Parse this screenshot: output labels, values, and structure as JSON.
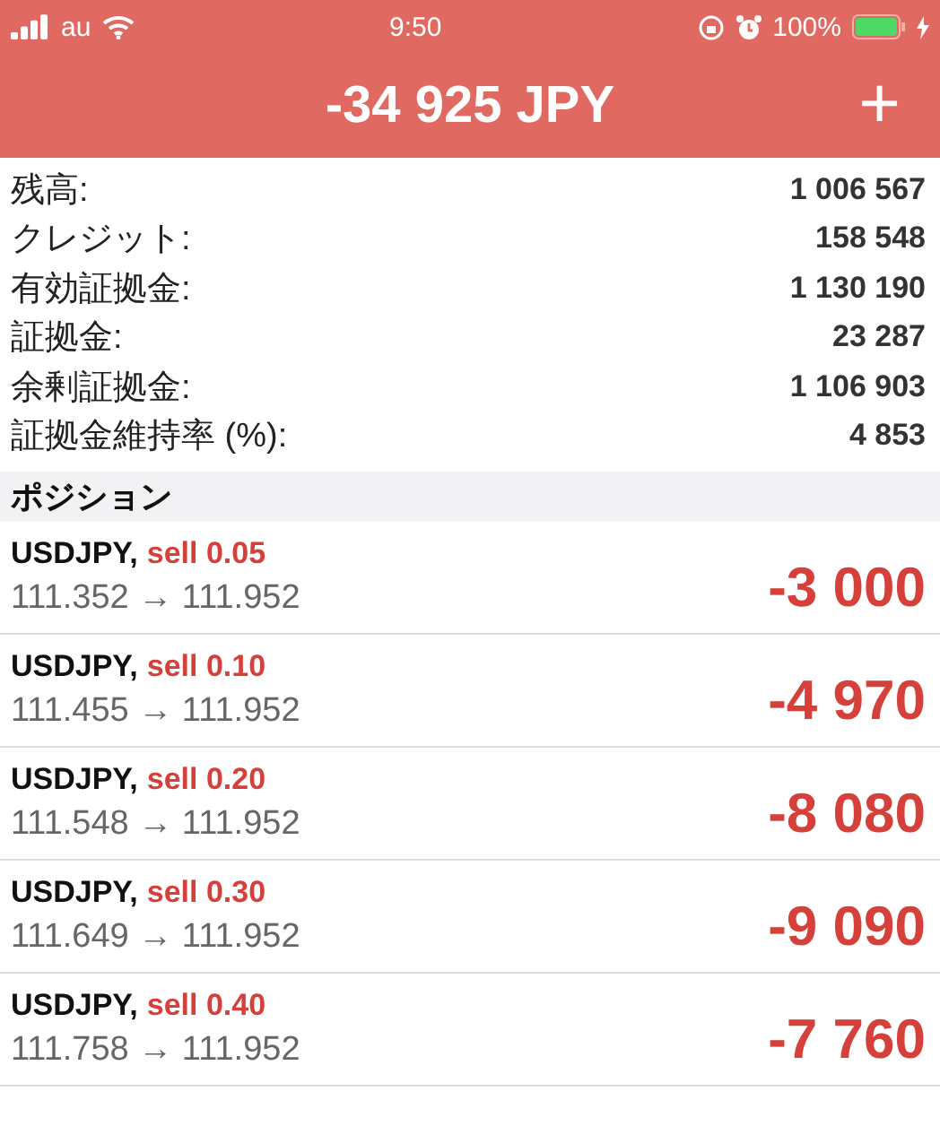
{
  "status_bar": {
    "carrier": "au",
    "time": "9:50",
    "battery": "100%"
  },
  "header": {
    "title": "-34 925 JPY",
    "action": "+"
  },
  "summary": [
    {
      "label": "残高:",
      "value": "1 006 567"
    },
    {
      "label": "クレジット:",
      "value": "158 548"
    },
    {
      "label": "有効証拠金:",
      "value": "1 130 190"
    },
    {
      "label": "証拠金:",
      "value": "23 287"
    },
    {
      "label": "余剰証拠金:",
      "value": "1 106 903"
    },
    {
      "label": "証拠金維持率 (%):",
      "value": "4 853"
    }
  ],
  "positions_section": {
    "title": "ポジション"
  },
  "positions": [
    {
      "symbol": "USDJPY,",
      "order": "sell 0.05",
      "prices": "111.352 → 111.952",
      "profit": "-3 000"
    },
    {
      "symbol": "USDJPY,",
      "order": "sell 0.10",
      "prices": "111.455 → 111.952",
      "profit": "-4 970"
    },
    {
      "symbol": "USDJPY,",
      "order": "sell 0.20",
      "prices": "111.548 → 111.952",
      "profit": "-8 080"
    },
    {
      "symbol": "USDJPY,",
      "order": "sell 0.30",
      "prices": "111.649 → 111.952",
      "profit": "-9 090"
    },
    {
      "symbol": "USDJPY,",
      "order": "sell 0.40",
      "prices": "111.758 → 111.952",
      "profit": "-7 760"
    }
  ]
}
